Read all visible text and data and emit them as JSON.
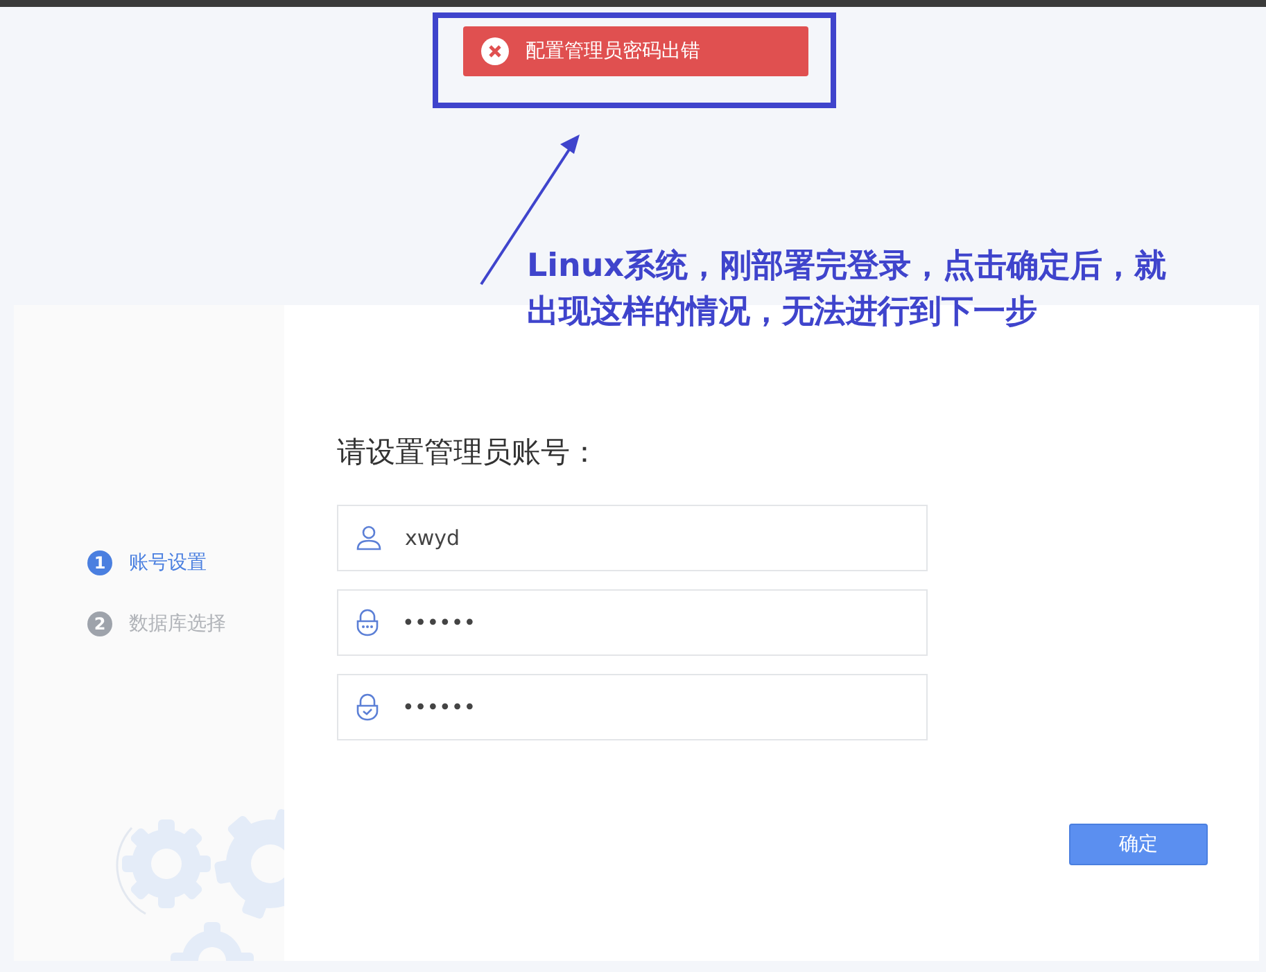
{
  "toast": {
    "message": "配置管理员密码出错"
  },
  "annotation": {
    "lines": [
      "Linux系统，刚部署完登录，点击确定后，就",
      "出现这样的情况，无法进行到下一步"
    ]
  },
  "steps": [
    {
      "number": "1",
      "label": "账号设置",
      "selected": true
    },
    {
      "number": "2",
      "label": "数据库选择",
      "selected": false
    }
  ],
  "form": {
    "title": "请设置管理员账号：",
    "fields": [
      {
        "kind": "user",
        "value": "xwyd"
      },
      {
        "kind": "password",
        "value": "••••••"
      },
      {
        "kind": "confirm",
        "value": "••••••"
      }
    ],
    "button": "确定"
  }
}
